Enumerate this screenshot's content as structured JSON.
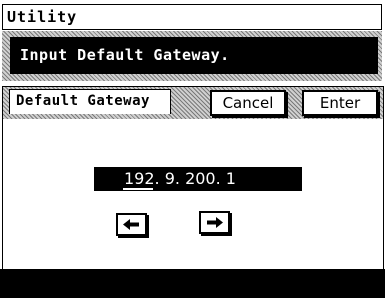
{
  "window": {
    "title": "Utility"
  },
  "message": {
    "text": "Input Default Gateway."
  },
  "field": {
    "label": "Default Gateway",
    "value": "192. 9. 200. 1"
  },
  "buttons": {
    "cancel": "Cancel",
    "enter": "Enter"
  },
  "icons": {
    "left": "arrow-left-icon",
    "right": "arrow-right-icon"
  },
  "colors": {
    "background": "#ffffff",
    "foreground": "#000000"
  }
}
